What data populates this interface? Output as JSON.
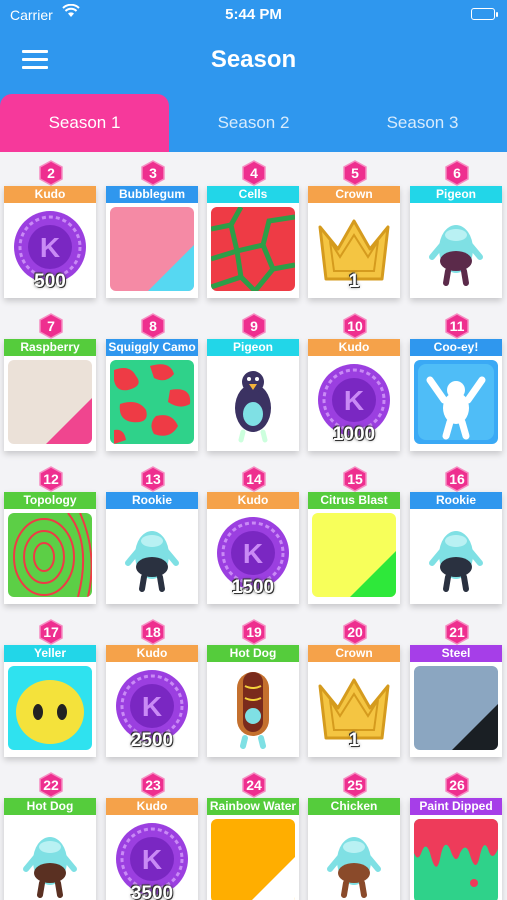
{
  "status": {
    "carrier": "Carrier",
    "time": "5:44 PM"
  },
  "header": {
    "title": "Season"
  },
  "tabs": [
    {
      "label": "Season 1",
      "active": true
    },
    {
      "label": "Season 2",
      "active": false
    },
    {
      "label": "Season 3",
      "active": false
    }
  ],
  "rewards": [
    {
      "tier": "2",
      "label": "Kudo",
      "label_color": "#f5a24a",
      "type": "kudo",
      "amount": "500"
    },
    {
      "tier": "3",
      "label": "Bubblegum",
      "label_color": "#2f97ee",
      "type": "colors2",
      "c1": "#f58aa5",
      "c2": "#56d8f2"
    },
    {
      "tier": "4",
      "label": "Cells",
      "label_color": "#22d6e8",
      "type": "cells"
    },
    {
      "tier": "5",
      "label": "Crown",
      "label_color": "#f5a24a",
      "type": "crown",
      "amount": "1"
    },
    {
      "tier": "6",
      "label": "Pigeon",
      "label_color": "#22d6e8",
      "type": "bean",
      "bean_color": "#7fe0e4",
      "accent": "#5b2a4a"
    },
    {
      "tier": "7",
      "label": "Raspberry",
      "label_color": "#55cc3c",
      "type": "colors2",
      "c1": "#ebe1d8",
      "c2": "#f0458f"
    },
    {
      "tier": "8",
      "label": "Squiggly Camo",
      "label_color": "#2f97ee",
      "type": "camo"
    },
    {
      "tier": "9",
      "label": "Pigeon",
      "label_color": "#22d6e8",
      "type": "pigeon"
    },
    {
      "tier": "10",
      "label": "Kudo",
      "label_color": "#f5a24a",
      "type": "kudo",
      "amount": "1000"
    },
    {
      "tier": "11",
      "label": "Coo-ey!",
      "label_color": "#2f97ee",
      "type": "emote"
    },
    {
      "tier": "12",
      "label": "Topology",
      "label_color": "#55cc3c",
      "type": "topology"
    },
    {
      "tier": "13",
      "label": "Rookie",
      "label_color": "#2f97ee",
      "type": "bean",
      "bean_color": "#7fe0e4",
      "accent": "#2a3140"
    },
    {
      "tier": "14",
      "label": "Kudo",
      "label_color": "#f5a24a",
      "type": "kudo",
      "amount": "1500"
    },
    {
      "tier": "15",
      "label": "Citrus Blast",
      "label_color": "#55cc3c",
      "type": "colors2",
      "c1": "#f7ff5a",
      "c2": "#2ee83a"
    },
    {
      "tier": "16",
      "label": "Rookie",
      "label_color": "#2f97ee",
      "type": "bean",
      "bean_color": "#7fe0e4",
      "accent": "#2a3140"
    },
    {
      "tier": "17",
      "label": "Yeller",
      "label_color": "#22d6e8",
      "type": "yeller"
    },
    {
      "tier": "18",
      "label": "Kudo",
      "label_color": "#f5a24a",
      "type": "kudo",
      "amount": "2500"
    },
    {
      "tier": "19",
      "label": "Hot Dog",
      "label_color": "#55cc3c",
      "type": "hotdog"
    },
    {
      "tier": "20",
      "label": "Crown",
      "label_color": "#f5a24a",
      "type": "crown",
      "amount": "1"
    },
    {
      "tier": "21",
      "label": "Steel",
      "label_color": "#a63ee8",
      "type": "colors2",
      "c1": "#8ba6c1",
      "c2": "#1a1f24"
    },
    {
      "tier": "22",
      "label": "Hot Dog",
      "label_color": "#55cc3c",
      "type": "bean",
      "bean_color": "#7fe0e4",
      "accent": "#5a3022"
    },
    {
      "tier": "23",
      "label": "Kudo",
      "label_color": "#f5a24a",
      "type": "kudo",
      "amount": "3500"
    },
    {
      "tier": "24",
      "label": "Rainbow Water",
      "label_color": "#55cc3c",
      "type": "colors2",
      "c1": "#ffae00",
      "c2": "#ffffff"
    },
    {
      "tier": "25",
      "label": "Chicken",
      "label_color": "#55cc3c",
      "type": "bean",
      "bean_color": "#7fe0e4",
      "accent": "#8a4a2a"
    },
    {
      "tier": "26",
      "label": "Paint Dipped",
      "label_color": "#a63ee8",
      "type": "paint"
    }
  ]
}
